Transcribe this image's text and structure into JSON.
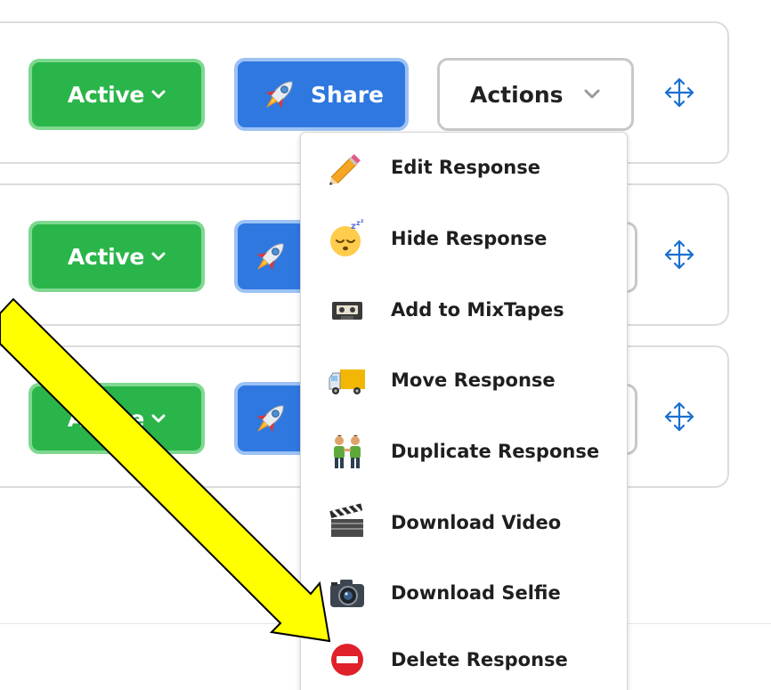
{
  "rows": [
    {
      "status_label": "Active",
      "share_label": "Share",
      "actions_label": "Actions"
    },
    {
      "status_label": "Active"
    },
    {
      "status_label": "Active"
    }
  ],
  "actions_menu": {
    "items": [
      {
        "label": "Edit Response",
        "icon": "pencil-icon"
      },
      {
        "label": "Hide Response",
        "icon": "sleeping-face-icon"
      },
      {
        "label": "Add to MixTapes",
        "icon": "cassette-tape-icon"
      },
      {
        "label": "Move Response",
        "icon": "delivery-truck-icon"
      },
      {
        "label": "Duplicate Response",
        "icon": "two-people-icon"
      },
      {
        "label": "Download Video",
        "icon": "clapper-board-icon"
      },
      {
        "label": "Download Selfie",
        "icon": "camera-icon"
      },
      {
        "label": "Delete Response",
        "icon": "no-entry-icon"
      }
    ]
  },
  "colors": {
    "active_green": "#2ab54a",
    "share_blue": "#2f78e0",
    "move_handle_blue": "#1b6fd1",
    "annotation_arrow_fill": "#ffff00",
    "delete_red": "#e0202a"
  },
  "annotation": {
    "type": "arrow",
    "points_to": "Delete Response"
  }
}
